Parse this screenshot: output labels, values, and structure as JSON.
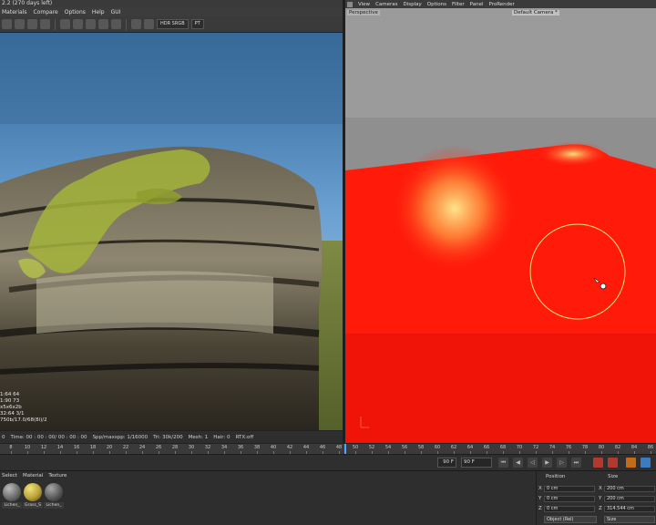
{
  "live_viewer": {
    "title": "2.2 (270 days left)",
    "menu": [
      "Materials",
      "Compare",
      "Options",
      "Help",
      "GUI"
    ],
    "toolbar": {
      "color_space": "HDR SRGB",
      "kernel": "PT"
    },
    "overlay_lines": [
      "1:64     64",
      "1:90     73",
      "x5x6x2b",
      "32:64  3/1",
      "750b/17.0/68(8i)/2"
    ],
    "stats": {
      "frame": "0",
      "time": "Time: 00 : 00 : 00/ 00 : 00 : 00",
      "spp": "Spp/maxspp: 1/16000",
      "tri": "Tri: 30k/200",
      "mesh": "Mesh: 1",
      "hair": "Hair: 0",
      "rtx": "RTX:off"
    }
  },
  "viewport": {
    "menu": [
      "View",
      "Cameras",
      "Display",
      "Options",
      "Filter",
      "Panel",
      "ProRender"
    ],
    "label": "Perspective",
    "camera": "Default Camera *"
  },
  "timeline": {
    "ticks": [
      "8",
      "10",
      "12",
      "14",
      "16",
      "18",
      "20",
      "22",
      "24",
      "26",
      "28",
      "30",
      "32",
      "34",
      "36",
      "38",
      "40",
      "42",
      "44",
      "46",
      "48",
      "50",
      "52",
      "54",
      "56",
      "58",
      "60",
      "62",
      "64",
      "66",
      "68",
      "70",
      "72",
      "74",
      "76",
      "78",
      "80",
      "82",
      "84",
      "86"
    ]
  },
  "playback": {
    "start_field": "90 F",
    "end_field": "90 F"
  },
  "material_manager": {
    "menu": [
      "Select",
      "Material",
      "Texture"
    ],
    "materials": [
      {
        "label": "Lichen_",
        "color": "#6d6d6d"
      },
      {
        "label": "Grass_S",
        "color": "#b8a23a"
      },
      {
        "label": "Lichen_",
        "color": "#5a5a5a"
      }
    ]
  },
  "coordinates": {
    "position_header": "Position",
    "size_header": "Size",
    "rows": [
      {
        "axis": "X",
        "position": "0 cm",
        "size_axis": "X",
        "size": "200 cm"
      },
      {
        "axis": "Y",
        "position": "0 cm",
        "size_axis": "Y",
        "size": "200 cm"
      },
      {
        "axis": "Z",
        "position": "0 cm",
        "size_axis": "Z",
        "size": "314.544 cm"
      }
    ],
    "mode": "Object (Rel)",
    "size_mode": "Size"
  },
  "colors": {
    "viewport_plane": "#ff1a0a",
    "highlight": "#ffe48a",
    "accent": "#4fa5ff"
  }
}
